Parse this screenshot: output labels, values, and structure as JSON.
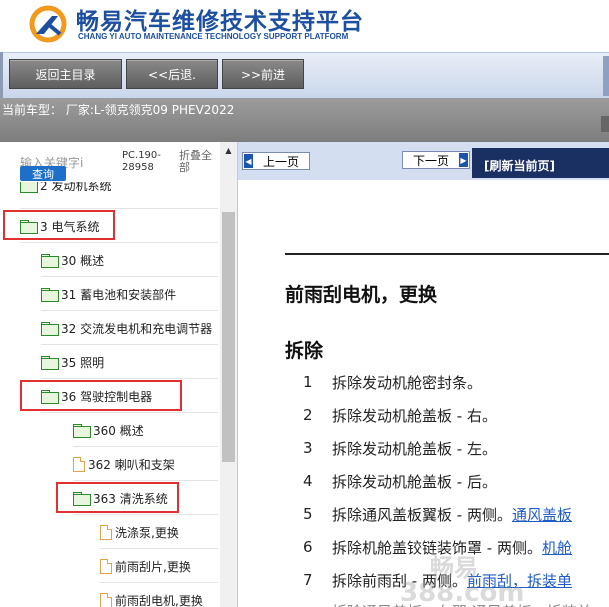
{
  "header": {
    "title": "畅易汽车维修技术支持平台",
    "subtitle": "CHANG YI AUTO MAINTENANCE TECHNOLOGY SUPPORT PLATFORM",
    "brand_color": "#1d4fa0"
  },
  "toolbar": {
    "home_label": "返回主目录",
    "back_label": "<<后退.",
    "forward_label": ">>前进"
  },
  "vehicle": {
    "text": "当前车型： 厂家:L-领克领克09 PHEV2022"
  },
  "search": {
    "placeholder": "输入关键字i",
    "button_label": "查询",
    "pc_code": "PC.190-28958",
    "fold_all": "折叠全部"
  },
  "tree": [
    {
      "label": "2 发动机系统",
      "icon": "folder-icon"
    },
    {
      "label": "3 电气系统",
      "icon": "folder-icon",
      "highlighted": true
    },
    {
      "label": "30 概述",
      "icon": "folder-icon"
    },
    {
      "label": "31 蓄电池和安装部件",
      "icon": "folder-icon"
    },
    {
      "label": "32 交流发电机和充电调节器",
      "icon": "folder-icon"
    },
    {
      "label": "35 照明",
      "icon": "folder-icon"
    },
    {
      "label": "36 驾驶控制电器",
      "icon": "folder-icon",
      "highlighted": true
    },
    {
      "label": "360 概述",
      "icon": "folder-icon"
    },
    {
      "label": "362 喇叭和支架",
      "icon": "document-icon"
    },
    {
      "label": "363 清洗系统",
      "icon": "folder-icon",
      "highlighted": true
    },
    {
      "label": "洗涤泵,更换",
      "icon": "document-icon"
    },
    {
      "label": "前雨刮片,更换",
      "icon": "document-icon"
    },
    {
      "label": "前雨刮电机,更换",
      "icon": "document-icon"
    }
  ],
  "pager": {
    "prev_label": "上一页",
    "next_label": "下一页",
    "refresh_label": "[刷新当前页]"
  },
  "document": {
    "title": "前雨刮电机，更换",
    "section": "拆除",
    "steps": [
      {
        "num": "1",
        "text": "拆除发动机舱密封条。",
        "link": ""
      },
      {
        "num": "2",
        "text": "拆除发动机舱盖板 - 右。",
        "link": ""
      },
      {
        "num": "3",
        "text": "拆除发动机舱盖板 - 左。",
        "link": ""
      },
      {
        "num": "4",
        "text": "拆除发动机舱盖板 - 后。",
        "link": ""
      },
      {
        "num": "5",
        "text": "拆除通风盖板翼板 - 两侧。",
        "link": "通风盖板"
      },
      {
        "num": "6",
        "text": "拆除机舱盖铰链装饰罩 - 两侧。",
        "link": "机舱"
      },
      {
        "num": "7",
        "text": "拆除前雨刮 - 两侧。",
        "link": "前雨刮，拆装单"
      },
      {
        "num": "",
        "text": "拆除通风盖板 - 左翼 通风盖板 - 拆装单",
        "link": ""
      }
    ]
  },
  "watermark": {
    "line1": "畅易",
    "line2": "388.com"
  }
}
